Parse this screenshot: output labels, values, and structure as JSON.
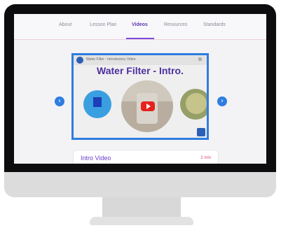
{
  "nav": {
    "tabs": [
      {
        "label": "About"
      },
      {
        "label": "Lesson Plan"
      },
      {
        "label": "Videos",
        "active": true
      },
      {
        "label": "Resources"
      },
      {
        "label": "Standards"
      }
    ]
  },
  "player": {
    "video_title": "Water Filter - Introductory Video",
    "overlay_title": "Water Filter - Intro."
  },
  "card": {
    "title": "Intro Video",
    "duration": "2 min"
  },
  "colors": {
    "accent": "#7c4ddb",
    "player_border": "#2f7de0",
    "duration": "#e0457a"
  }
}
